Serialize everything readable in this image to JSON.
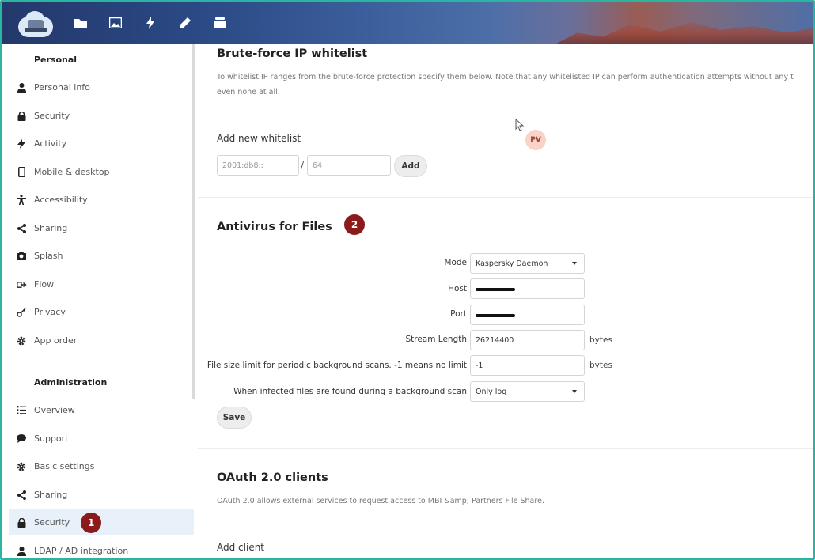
{
  "header": {
    "app_icons": [
      "files-icon",
      "photos-icon",
      "activity-icon",
      "notes-icon",
      "deck-icon"
    ]
  },
  "sidebar": {
    "personal_title": "Personal",
    "personal_items": [
      {
        "label": "Personal info",
        "icon": "user-icon"
      },
      {
        "label": "Security",
        "icon": "lock-icon"
      },
      {
        "label": "Activity",
        "icon": "lightning-icon"
      },
      {
        "label": "Mobile & desktop",
        "icon": "phone-icon"
      },
      {
        "label": "Accessibility",
        "icon": "accessibility-icon"
      },
      {
        "label": "Sharing",
        "icon": "share-icon"
      },
      {
        "label": "Splash",
        "icon": "camera-icon"
      },
      {
        "label": "Flow",
        "icon": "flow-icon"
      },
      {
        "label": "Privacy",
        "icon": "key-icon"
      },
      {
        "label": "App order",
        "icon": "gear-icon"
      }
    ],
    "admin_title": "Administration",
    "admin_items": [
      {
        "label": "Overview",
        "icon": "list-icon"
      },
      {
        "label": "Support",
        "icon": "chat-icon"
      },
      {
        "label": "Basic settings",
        "icon": "gear-icon"
      },
      {
        "label": "Sharing",
        "icon": "share-icon"
      },
      {
        "label": "Security",
        "icon": "lock-icon",
        "active": true,
        "badge": "1"
      },
      {
        "label": "LDAP / AD integration",
        "icon": "user-icon"
      }
    ]
  },
  "bruteforce": {
    "title": "Brute-force IP whitelist",
    "hint_line1": "To whitelist IP ranges from the brute-force protection specify them below. Note that any whitelisted IP can perform authentication attempts without any t",
    "hint_line2": "even none at all.",
    "add_label": "Add new whitelist",
    "ip_placeholder": "2001:db8::",
    "mask_placeholder": "64",
    "slash": "/",
    "add_button": "Add",
    "avatar_initials": "PV"
  },
  "antivirus": {
    "title": "Antivirus for Files",
    "badge": "2",
    "mode_label": "Mode",
    "mode_value": "Kaspersky Daemon",
    "host_label": "Host",
    "port_label": "Port",
    "stream_label": "Stream Length",
    "stream_value": "26214400",
    "stream_unit": "bytes",
    "filesize_label": "File size limit for periodic background scans. -1 means no limit",
    "filesize_value": "-1",
    "filesize_unit": "bytes",
    "infected_label": "When infected files are found during a background scan",
    "infected_value": "Only log",
    "save_button": "Save"
  },
  "oauth": {
    "title": "OAuth 2.0 clients",
    "hint": "OAuth 2.0 allows external services to request access to MBI &amp; Partners File Share.",
    "add_client": "Add client"
  }
}
